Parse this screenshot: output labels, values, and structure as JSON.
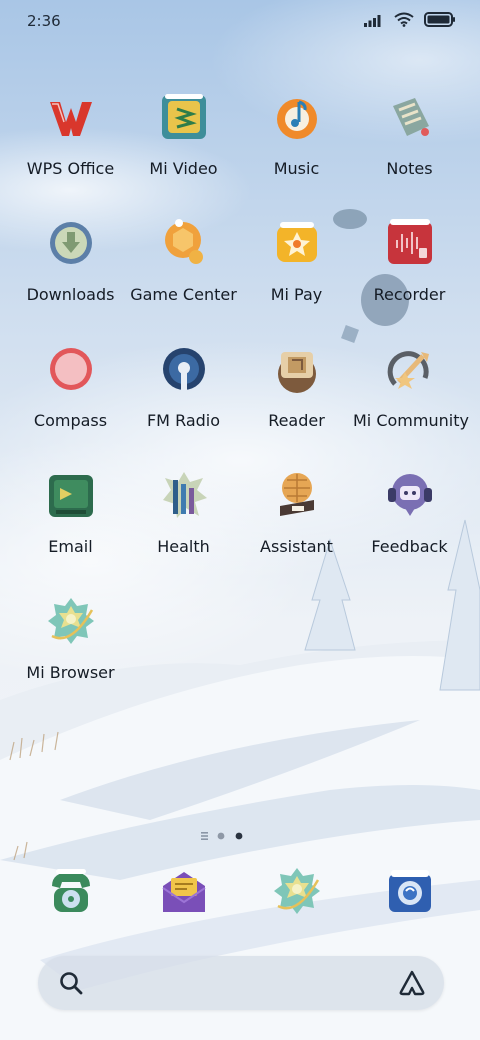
{
  "status": {
    "time": "2:36",
    "icons": [
      "signal-icon",
      "wifi-icon",
      "battery-icon"
    ]
  },
  "apps": [
    {
      "label": "WPS Office",
      "icon": "wps-office-icon"
    },
    {
      "label": "Mi Video",
      "icon": "mi-video-icon"
    },
    {
      "label": "Music",
      "icon": "music-icon"
    },
    {
      "label": "Notes",
      "icon": "notes-icon"
    },
    {
      "label": "Downloads",
      "icon": "downloads-icon"
    },
    {
      "label": "Game Center",
      "icon": "game-center-icon"
    },
    {
      "label": "Mi Pay",
      "icon": "mi-pay-icon"
    },
    {
      "label": "Recorder",
      "icon": "recorder-icon"
    },
    {
      "label": "Compass",
      "icon": "compass-icon"
    },
    {
      "label": "FM Radio",
      "icon": "fm-radio-icon"
    },
    {
      "label": "Reader",
      "icon": "reader-icon"
    },
    {
      "label": "Mi Community",
      "icon": "mi-community-icon"
    },
    {
      "label": "Email",
      "icon": "email-icon"
    },
    {
      "label": "Health",
      "icon": "health-icon"
    },
    {
      "label": "Assistant",
      "icon": "assistant-icon"
    },
    {
      "label": "Feedback",
      "icon": "feedback-icon"
    },
    {
      "label": "Mi Browser",
      "icon": "mi-browser-icon"
    }
  ],
  "page_indicator": {
    "pages": 3,
    "current": 3
  },
  "dock": [
    {
      "icon": "phone-icon"
    },
    {
      "icon": "messages-icon"
    },
    {
      "icon": "browser-icon"
    },
    {
      "icon": "camera-icon"
    }
  ],
  "search": {
    "icons": [
      "search-icon",
      "assistant-shortcut-icon"
    ]
  }
}
